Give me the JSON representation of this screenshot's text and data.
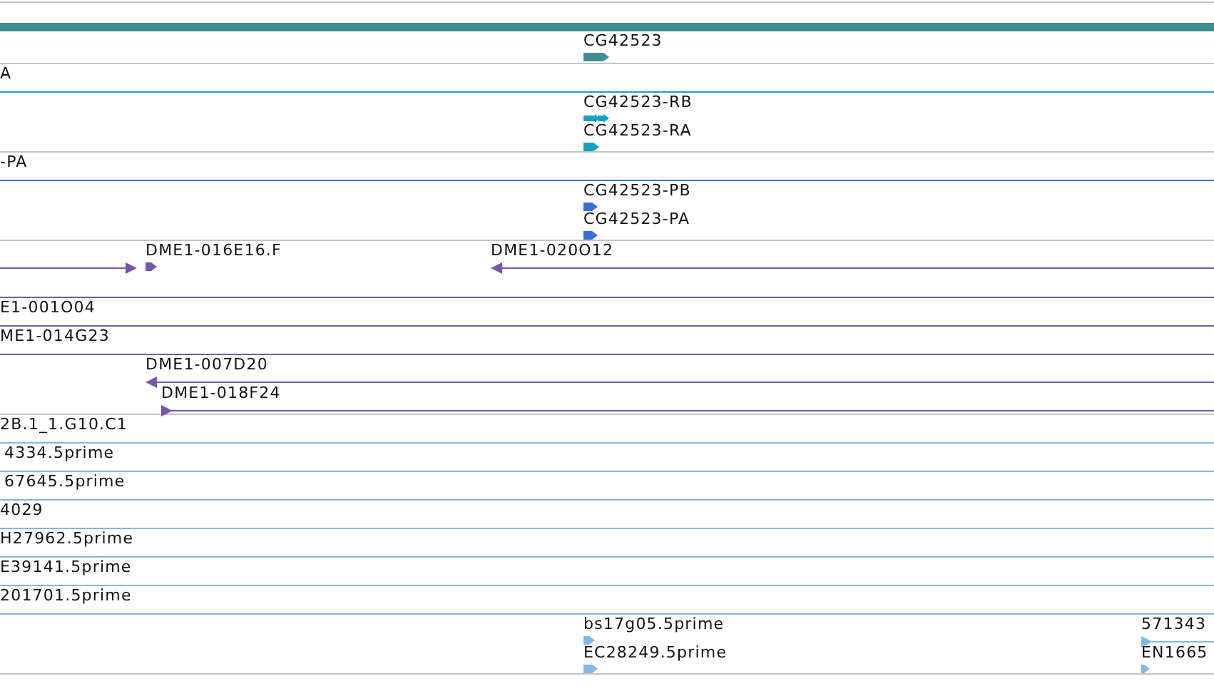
{
  "tracks": [
    {
      "color": "#418e90",
      "lanes": [
        {
          "features": [
            {
              "kind": "thick"
            }
          ]
        },
        {
          "features": [
            {
              "label": "CG42523",
              "kind": "block"
            }
          ]
        }
      ]
    },
    {
      "color": "#1aa0c4",
      "lanes": [
        {
          "features": [
            {
              "label": "A",
              "kind": "span"
            }
          ]
        },
        {
          "features": [
            {
              "label": "CG42523-RB",
              "kind": "double"
            }
          ]
        },
        {
          "features": [
            {
              "label": "CG42523-RA",
              "kind": "block"
            }
          ]
        }
      ]
    },
    {
      "color": "#3a6ed0",
      "lanes": [
        {
          "features": [
            {
              "label": "-PA",
              "kind": "span"
            }
          ]
        },
        {
          "features": [
            {
              "label": "CG42523-PB",
              "kind": "block"
            }
          ]
        },
        {
          "features": [
            {
              "label": "CG42523-PA",
              "kind": "block"
            }
          ]
        }
      ]
    },
    {
      "color": "#7656ad",
      "lanes": [
        {
          "features": [
            {
              "kind": "ends_right"
            },
            {
              "label": "DME1-016E16.F",
              "kind": "block"
            },
            {
              "label": "DME1-020O12",
              "kind": "open_left"
            }
          ]
        },
        {
          "features": [
            {
              "kind": "span"
            }
          ]
        },
        {
          "features": [
            {
              "label": "E1-001O04",
              "kind": "span"
            }
          ]
        },
        {
          "features": [
            {
              "label": "ME1-014G23",
              "kind": "span"
            }
          ]
        },
        {
          "features": [
            {
              "label": "DME1-007D20",
              "kind": "open_left"
            }
          ]
        },
        {
          "features": [
            {
              "label": "DME1-018F24",
              "kind": "open_right"
            }
          ]
        }
      ]
    },
    {
      "color": "#82b9e0",
      "lanes": [
        {
          "features": [
            {
              "label": "2B.1_1.G10.C1",
              "kind": "span"
            }
          ]
        },
        {
          "features": [
            {
              "label": "4334.5prime",
              "kind": "span"
            }
          ]
        },
        {
          "features": [
            {
              "label": "67645.5prime",
              "kind": "span"
            }
          ]
        },
        {
          "features": [
            {
              "label": "4029",
              "kind": "span"
            }
          ]
        },
        {
          "features": [
            {
              "label": "H27962.5prime",
              "kind": "span"
            }
          ]
        },
        {
          "features": [
            {
              "label": "E39141.5prime",
              "kind": "span"
            }
          ]
        },
        {
          "features": [
            {
              "label": "201701.5prime",
              "kind": "span"
            }
          ]
        },
        {
          "features": [
            {
              "label": "bs17g05.5prime",
              "kind": "block"
            },
            {
              "label": "571343",
              "kind": "open_right"
            }
          ]
        },
        {
          "features": [
            {
              "label": "EC28249.5prime",
              "kind": "block"
            },
            {
              "label": "EN1665",
              "kind": "block"
            }
          ]
        }
      ]
    }
  ]
}
